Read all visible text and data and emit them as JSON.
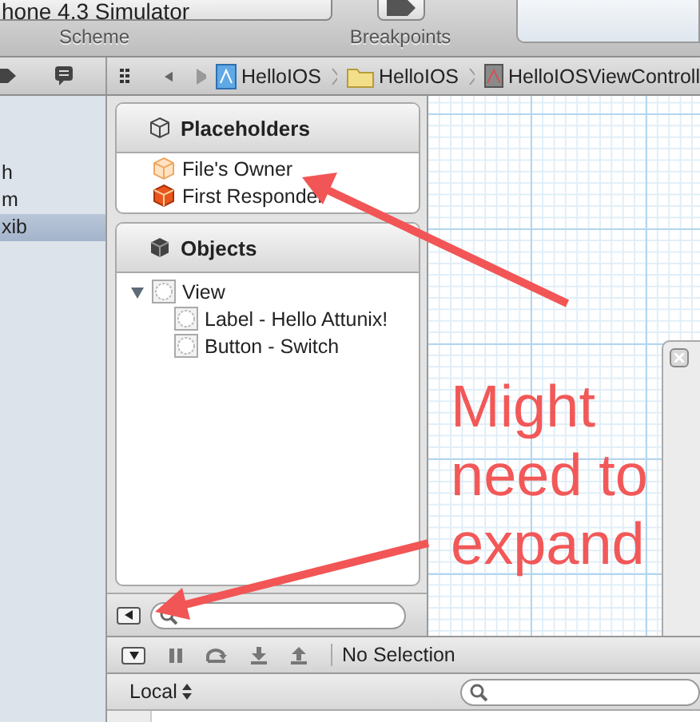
{
  "toolbar": {
    "scheme": {
      "value": "hone 4.3 Simulator",
      "label": "Scheme"
    },
    "breakpoints": {
      "label": "Breakpoints"
    }
  },
  "jump_bar": {
    "crumbs": [
      {
        "label": "HelloIOS",
        "kind": "project"
      },
      {
        "label": "HelloIOS",
        "kind": "folder"
      },
      {
        "label": "HelloIOSViewControll",
        "kind": "file"
      }
    ]
  },
  "navigator": {
    "items": [
      {
        "label": "h",
        "selected": false
      },
      {
        "label": "m",
        "selected": false
      },
      {
        "label": "xib",
        "selected": true
      }
    ]
  },
  "object_panel": {
    "placeholders": {
      "title": "Placeholders",
      "items": [
        {
          "label": "File's Owner",
          "kind": "owner"
        },
        {
          "label": "First Responder",
          "kind": "responder"
        }
      ]
    },
    "objects": {
      "title": "Objects",
      "tree": [
        {
          "label": "View",
          "expanded": true,
          "children": [
            {
              "label": "Label - Hello Attunix!"
            },
            {
              "label": "Button - Switch"
            }
          ]
        }
      ]
    }
  },
  "debug_bar": {
    "status": "No Selection"
  },
  "variables_bar": {
    "scope": "Local"
  },
  "annotation": {
    "text": "Might need to expand"
  }
}
